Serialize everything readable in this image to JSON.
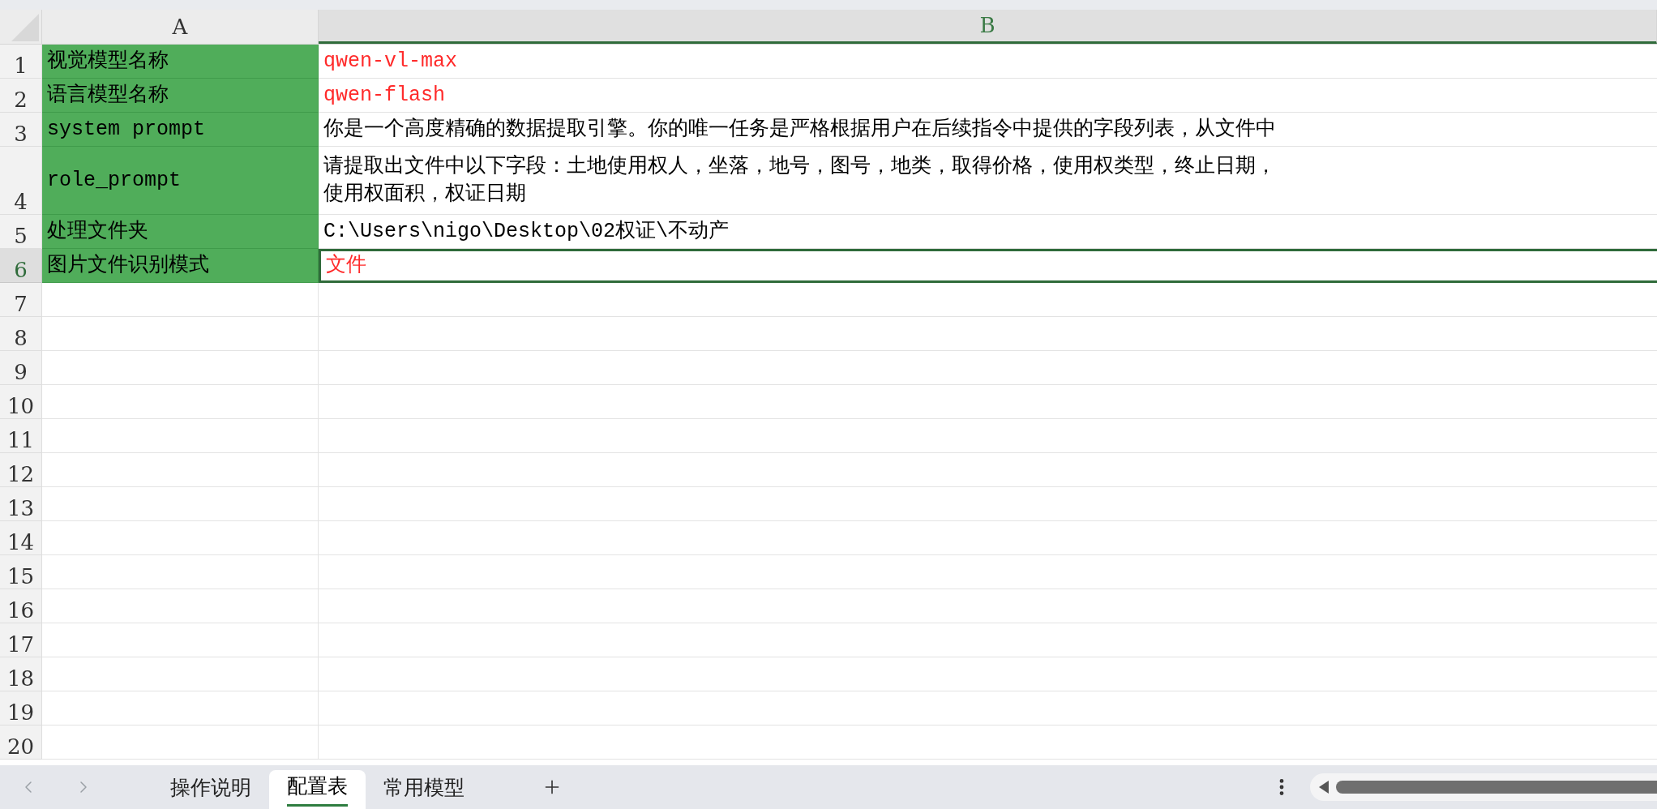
{
  "columns": [
    {
      "label": "A",
      "selected": false
    },
    {
      "label": "B",
      "selected": true
    }
  ],
  "rows": [
    {
      "number": "1",
      "selected": false,
      "cells": [
        {
          "text": "视觉模型名称"
        },
        {
          "text": "qwen-vl-max",
          "color": "#ff2a2a"
        }
      ]
    },
    {
      "number": "2",
      "selected": false,
      "cells": [
        {
          "text": "语言模型名称"
        },
        {
          "text": "qwen-flash",
          "color": "#ff2a2a"
        }
      ]
    },
    {
      "number": "3",
      "selected": false,
      "cells": [
        {
          "text": "system prompt"
        },
        {
          "text": "你是一个高度精确的数据提取引擎。你的唯一任务是严格根据用户在后续指令中提供的字段列表，从文件中",
          "color": "#000000"
        }
      ]
    },
    {
      "number": "4",
      "selected": false,
      "cells": [
        {
          "text": "role_prompt"
        },
        {
          "lines": [
            "请提取出文件中以下字段：土地使用权人，坐落，地号，图号，地类，取得价格，使用权类型，终止日期，",
            "使用权面积，权证日期"
          ],
          "color": "#000000"
        }
      ]
    },
    {
      "number": "5",
      "selected": false,
      "cells": [
        {
          "text": "处理文件夹"
        },
        {
          "text": "C:\\Users\\nigo\\Desktop\\02权证\\不动产",
          "color": "#000000"
        }
      ]
    },
    {
      "number": "6",
      "selected": true,
      "cells": [
        {
          "text": "图片文件识别模式"
        },
        {
          "text": "文件",
          "color": "#ff2a2a"
        }
      ]
    },
    {
      "number": "7",
      "selected": false
    },
    {
      "number": "8",
      "selected": false
    },
    {
      "number": "9",
      "selected": false
    },
    {
      "number": "10",
      "selected": false
    },
    {
      "number": "11",
      "selected": false
    },
    {
      "number": "12",
      "selected": false
    },
    {
      "number": "13",
      "selected": false
    },
    {
      "number": "14",
      "selected": false
    },
    {
      "number": "15",
      "selected": false
    },
    {
      "number": "16",
      "selected": false
    },
    {
      "number": "17",
      "selected": false
    },
    {
      "number": "18",
      "selected": false
    },
    {
      "number": "19",
      "selected": false
    },
    {
      "number": "20",
      "selected": false
    }
  ],
  "sheet_tabs": [
    {
      "label": "操作说明",
      "selected": false
    },
    {
      "label": "配置表",
      "selected": true
    },
    {
      "label": "常用模型",
      "selected": false
    }
  ]
}
